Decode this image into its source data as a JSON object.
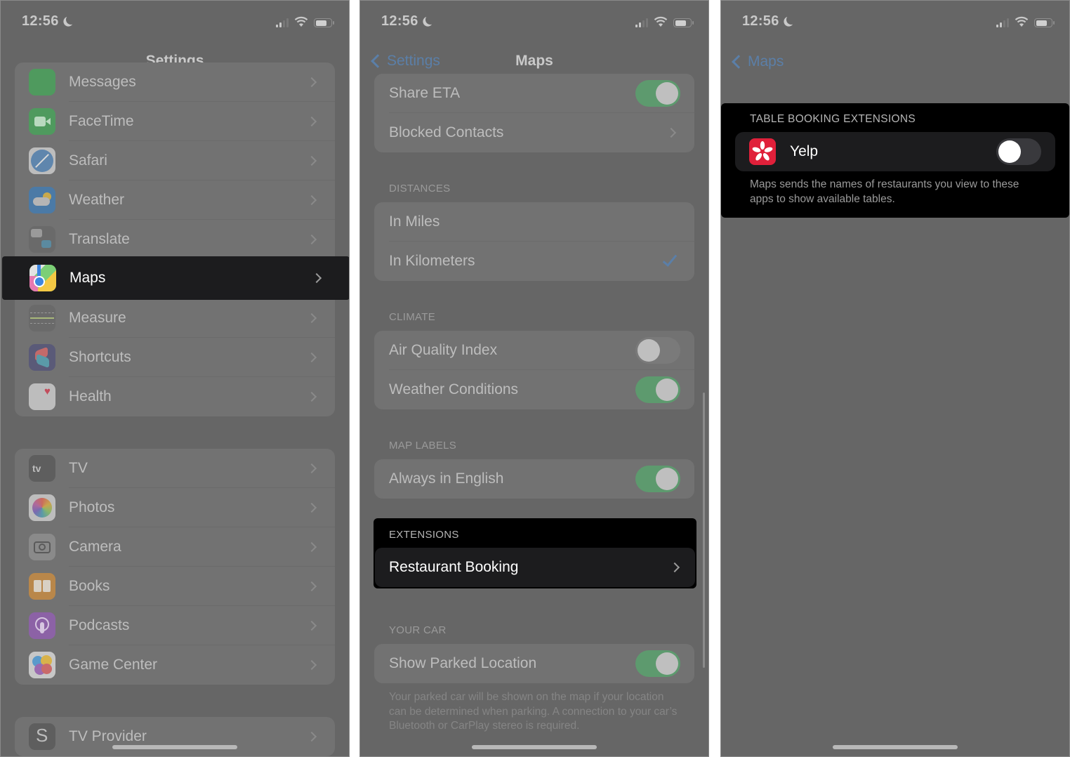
{
  "status_bar": {
    "time": "12:56"
  },
  "panel1": {
    "nav_title": "Settings",
    "group1": [
      {
        "label": "Messages",
        "icon": "messages-icon",
        "color": "#4f9a5e"
      },
      {
        "label": "FaceTime",
        "icon": "facetime-icon",
        "color": "#4f9a5e"
      },
      {
        "label": "Safari",
        "icon": "safari-icon",
        "color": "#8fa6bd"
      },
      {
        "label": "Weather",
        "icon": "weather-icon",
        "color": "#4b7aa6"
      },
      {
        "label": "Translate",
        "icon": "translate-icon",
        "color": "#6a6a6a"
      }
    ],
    "highlighted": {
      "label": "Maps",
      "icon": "maps-icon"
    },
    "group1b": [
      {
        "label": "Measure",
        "icon": "measure-icon",
        "color": "#6a6a6a"
      },
      {
        "label": "Shortcuts",
        "icon": "shortcuts-icon",
        "color": "#5a5a78"
      },
      {
        "label": "Health",
        "icon": "health-icon",
        "color": "#bdbdbd"
      }
    ],
    "group2": [
      {
        "label": "TV",
        "icon": "apple-tv-icon",
        "color": "#5e5e5e"
      },
      {
        "label": "Photos",
        "icon": "photos-icon",
        "color": "#bdbdbd"
      },
      {
        "label": "Camera",
        "icon": "camera-icon",
        "color": "#8a8a8a"
      },
      {
        "label": "Books",
        "icon": "books-icon",
        "color": "#b9874a"
      },
      {
        "label": "Podcasts",
        "icon": "podcasts-icon",
        "color": "#8c62a6"
      },
      {
        "label": "Game Center",
        "icon": "game-center-icon",
        "color": "#c7c7c7"
      }
    ],
    "group3": [
      {
        "label": "TV Provider",
        "icon": "tv-provider-icon",
        "color": "#5e5e5e"
      }
    ]
  },
  "panel2": {
    "back_label": "Settings",
    "nav_title": "Maps",
    "share_eta": {
      "label": "Share ETA",
      "on": true
    },
    "blocked_contacts": "Blocked Contacts",
    "distances": {
      "header": "DISTANCES",
      "options": [
        "In Miles",
        "In Kilometers"
      ],
      "selected": "In Kilometers"
    },
    "climate": {
      "header": "CLIMATE",
      "air_quality": {
        "label": "Air Quality Index",
        "on": false
      },
      "weather_conditions": {
        "label": "Weather Conditions",
        "on": true
      }
    },
    "map_labels": {
      "header": "MAP LABELS",
      "always_english": {
        "label": "Always in English",
        "on": true
      }
    },
    "extensions": {
      "header": "EXTENSIONS",
      "restaurant_booking": "Restaurant Booking"
    },
    "your_car": {
      "header": "YOUR CAR",
      "show_parked": {
        "label": "Show Parked Location",
        "on": true
      },
      "footnote": "Your parked car will be shown on the map if your location can be determined when parking. A connection to your car’s Bluetooth or CarPlay stereo is required."
    }
  },
  "panel3": {
    "back_label": "Maps",
    "header": "TABLE BOOKING EXTENSIONS",
    "yelp": {
      "label": "Yelp",
      "on": false
    },
    "note": "Maps sends the names of restaurants you view to these apps to show available tables."
  }
}
